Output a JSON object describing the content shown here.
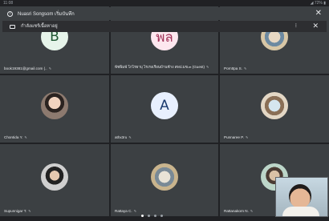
{
  "status_bar": {
    "time": "11:08",
    "system": "◢ 72% ▮"
  },
  "toast": {
    "message": "Nuasri Songsom เริ่มบันทึก",
    "close_icon": "close-icon"
  },
  "presenting": {
    "label": "กำลังแชร์เนื้อหาอยู่",
    "more_label": "⁝",
    "close_icon": "close-icon"
  },
  "participants": [
    {
      "name": "book19381@gmail.com (..",
      "initial": "B",
      "avatar_bg": "#e6f4ea",
      "avatar_fg": "#1e5631",
      "kind": "initial"
    },
    {
      "name": "พัชพิมพ์ โกไรยาบุ ไรเรงเรียนบ้านช้าง สพป.มข.๓ (Guest)",
      "initial": "พล",
      "avatar_bg": "#fde7ef",
      "avatar_fg": "#a2355a",
      "kind": "initial"
    },
    {
      "name": "Pornttpa S.",
      "kind": "photo6"
    },
    {
      "name": "Chontida Y.",
      "kind": "photo"
    },
    {
      "name": "athx3ru",
      "initial": "A",
      "avatar_bg": "#e8f0fe",
      "avatar_fg": "#1a3a6e",
      "kind": "initial"
    },
    {
      "name": "Punnaree P.",
      "kind": "photo5"
    },
    {
      "name": "Supunnigar T.",
      "kind": "photo3"
    },
    {
      "name": "Rattaya C.",
      "kind": "photo4"
    },
    {
      "name": "Rattanakorn N.",
      "kind": "photo2"
    }
  ],
  "pagination": {
    "count": 4,
    "active": 0
  }
}
